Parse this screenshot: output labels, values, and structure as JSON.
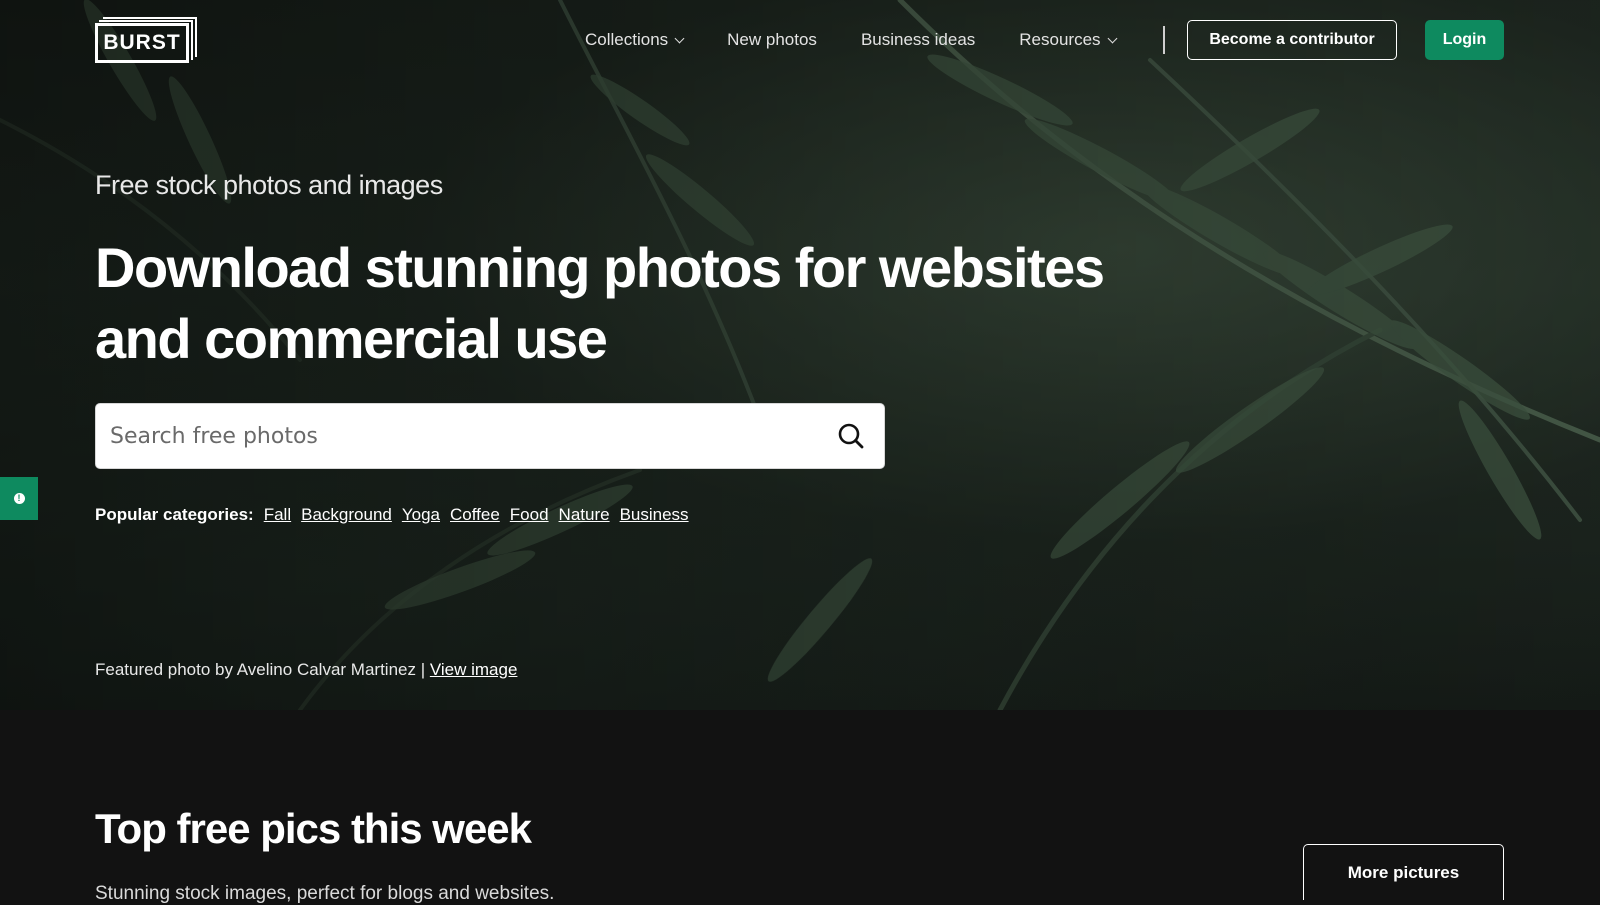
{
  "header": {
    "logo_text": "BURST",
    "nav": [
      {
        "label": "Collections",
        "has_dropdown": true
      },
      {
        "label": "New photos",
        "has_dropdown": false
      },
      {
        "label": "Business ideas",
        "has_dropdown": false
      },
      {
        "label": "Resources",
        "has_dropdown": true
      }
    ],
    "contributor_button": "Become a contributor",
    "login_button": "Login"
  },
  "hero": {
    "eyebrow": "Free stock photos and images",
    "headline": "Download stunning photos for websites and commercial use",
    "search": {
      "placeholder": "Search free photos",
      "icon": "search-icon"
    },
    "categories_label": "Popular categories:",
    "categories": [
      "Fall",
      "Background",
      "Yoga",
      "Coffee",
      "Food",
      "Nature",
      "Business"
    ],
    "featured_text": "Featured photo by Avelino Calvar Martinez |",
    "featured_link": "View image"
  },
  "feedback_tab": {
    "icon": "info-icon"
  },
  "section": {
    "title": "Top free pics this week",
    "subtitle": "Stunning stock images, perfect for blogs and websites.",
    "more_button": "More pictures"
  },
  "colors": {
    "accent": "#0e8a5f",
    "background": "#121212",
    "text": "#ffffff"
  }
}
